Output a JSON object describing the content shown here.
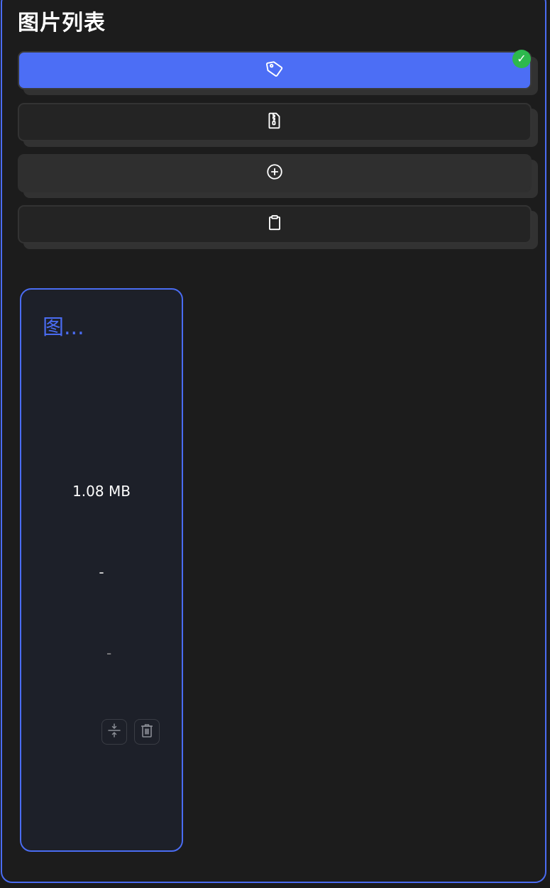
{
  "header": {
    "title": "图片列表"
  },
  "toolbar": {
    "buttons": [
      {
        "icon": "tag-icon",
        "state": "active",
        "badge": "✓"
      },
      {
        "icon": "zip-file-icon",
        "state": "normal"
      },
      {
        "icon": "plus-circle-icon",
        "state": "normal"
      },
      {
        "icon": "clipboard-icon",
        "state": "normal"
      }
    ]
  },
  "images": [
    {
      "name": "图...",
      "size": "1.08 MB",
      "compressed_size": "-",
      "ratio": "-",
      "actions": [
        "compress-icon",
        "trash-icon"
      ]
    }
  ],
  "colors": {
    "accent": "#4c6ef5",
    "success": "#2db84d",
    "background": "#1c1c1c"
  }
}
